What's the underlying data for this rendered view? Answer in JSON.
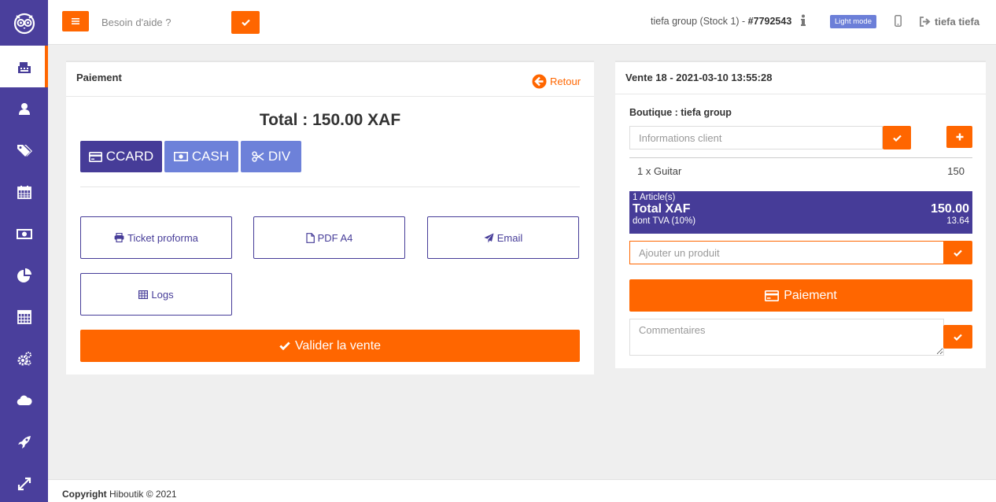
{
  "topbar": {
    "help_placeholder": "Besoin d'aide ?",
    "store_text": "tiefa group (Stock 1) - ",
    "store_id": "#7792543",
    "mode_badge": "Light mode",
    "user_name": "tiefa tiefa"
  },
  "sidebar": {
    "items": [
      {
        "icon": "cash-register-icon",
        "active": true
      },
      {
        "icon": "user-icon"
      },
      {
        "icon": "tags-icon"
      },
      {
        "icon": "calendar-icon"
      },
      {
        "icon": "money-icon"
      },
      {
        "icon": "pie-chart-icon"
      },
      {
        "icon": "calculator-icon"
      },
      {
        "icon": "gears-icon"
      },
      {
        "icon": "cloud-icon"
      },
      {
        "icon": "rocket-icon"
      },
      {
        "icon": "expand-icon"
      }
    ]
  },
  "payment": {
    "title": "Paiement",
    "back": "Retour",
    "total": "Total : 150.00 XAF",
    "methods": [
      "CCARD",
      "CASH",
      "DIV"
    ],
    "ticket": "Ticket proforma",
    "pdf": "PDF A4",
    "email": "Email",
    "logs": "Logs",
    "validate": "Valider la vente"
  },
  "sale": {
    "title": "Vente 18 - 2021-03-10 13:55:28",
    "shop": "Boutique : tiefa group",
    "client_placeholder": "Informations client",
    "item_label": "1 x Guitar",
    "item_price": "150",
    "count": "1 Article(s)",
    "total_label": "Total XAF",
    "total_value": "150.00",
    "tax_label": "dont TVA (10%)",
    "tax_value": "13.64",
    "product_placeholder": "Ajouter un produit",
    "pay_button": "Paiement",
    "comments_placeholder": "Commentaires"
  },
  "footer": {
    "copyright_label": "Copyright",
    "copyright_text": " Hiboutik © 2021"
  },
  "colors": {
    "sidebar": "#4a3f9c",
    "accent": "#ff6600",
    "primary": "#463c98",
    "secondary": "#6d81d9"
  }
}
